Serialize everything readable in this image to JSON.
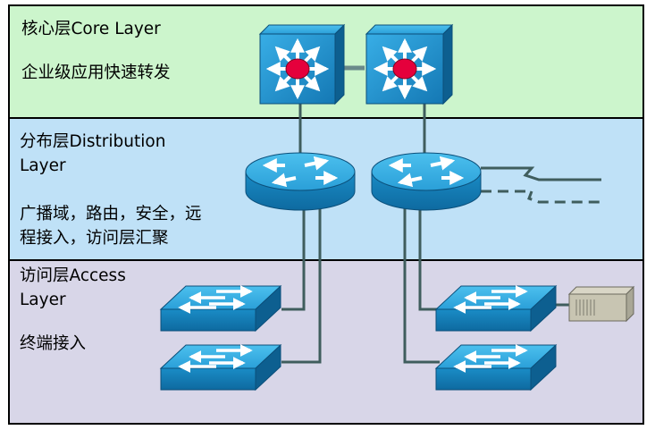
{
  "core": {
    "title": "核心层Core Layer",
    "desc": "企业级应用快速转发"
  },
  "distribution": {
    "title_line1": "分布层Distribution",
    "title_line2": "Layer",
    "desc_line1": "广播域，路由，安全，远",
    "desc_line2": "程接入，访问层汇聚"
  },
  "access": {
    "title_line1": "访问层Access",
    "title_line2": "Layer",
    "desc": "终端接入"
  },
  "colors": {
    "core_bg": "#ccf5cc",
    "distribution_bg": "#bfe1f7",
    "access_bg": "#d8d6e8",
    "device_blue": "#1e90c8",
    "link": "#3f5d5d"
  },
  "devices": {
    "core_switch_icon": "multilayer-switch-icon",
    "router_icon": "router-icon",
    "access_switch_icon": "workgroup-switch-icon",
    "server_icon": "server-icon"
  }
}
